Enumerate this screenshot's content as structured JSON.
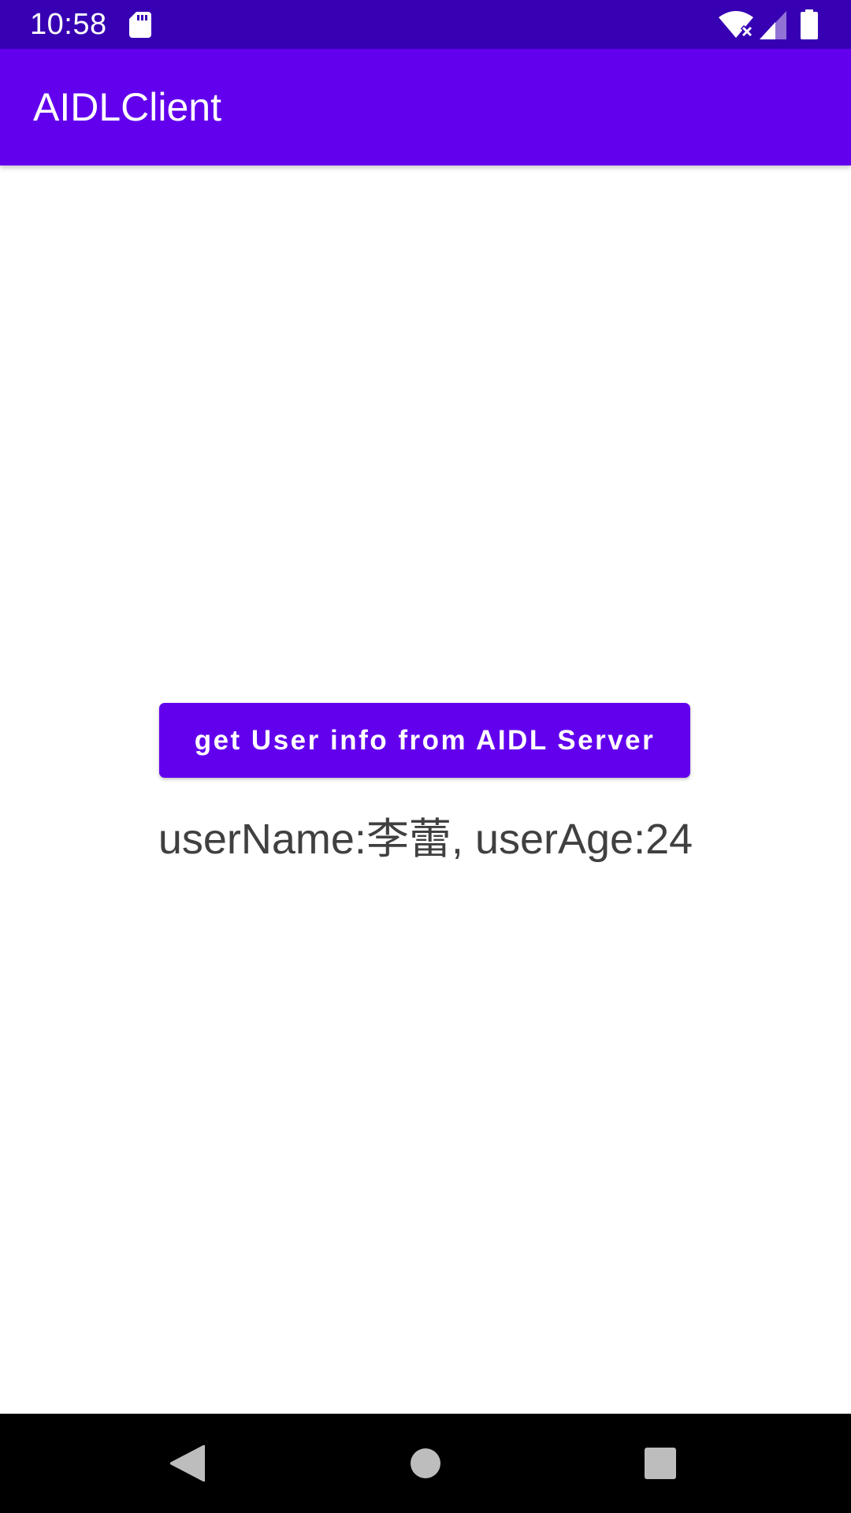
{
  "status_bar": {
    "time": "10:58",
    "icons": [
      "sd-card-icon",
      "wifi-icon",
      "signal-icon",
      "battery-icon"
    ]
  },
  "app_bar": {
    "title": "AIDLClient"
  },
  "main": {
    "button_label": "get User info from AIDL Server",
    "user_info": "userName:李蕾, userAge:24"
  },
  "nav_bar": {
    "icons": [
      "back-icon",
      "home-icon",
      "recents-icon"
    ]
  },
  "colors": {
    "status_bar": "#3700b3",
    "primary": "#6200ee",
    "text": "#404040",
    "nav_bar": "#000000"
  }
}
